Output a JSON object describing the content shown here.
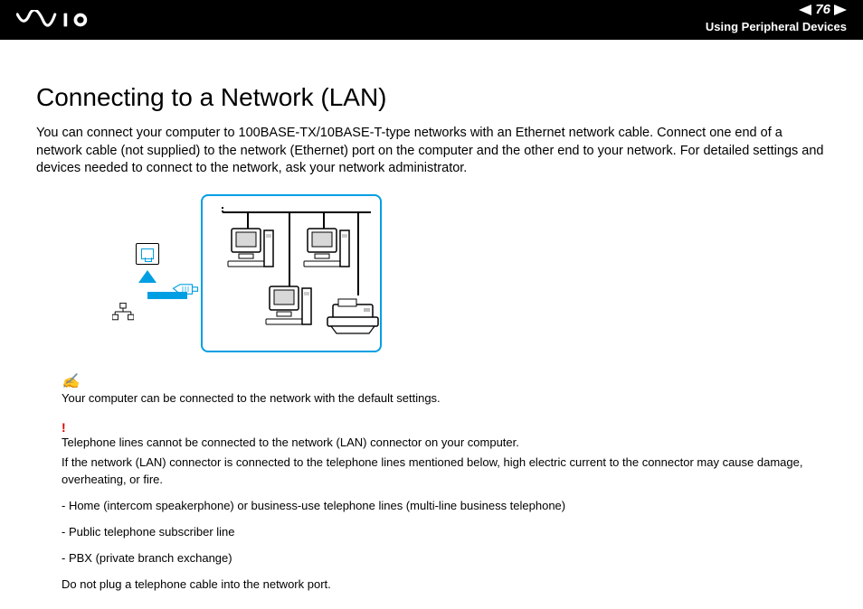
{
  "header": {
    "page_number": "76",
    "section": "Using Peripheral Devices"
  },
  "page": {
    "title": "Connecting to a Network (LAN)",
    "intro": "You can connect your computer to 100BASE-TX/10BASE-T-type networks with an Ethernet network cable. Connect one end of a network cable (not supplied) to the network (Ethernet) port on the computer and the other end to your network. For detailed settings and devices needed to connect to the network, ask your network administrator."
  },
  "note": {
    "text": "Your computer can be connected to the network with the default settings."
  },
  "warning": {
    "line1": "Telephone lines cannot be connected to the network (LAN) connector on your computer.",
    "line2": "If the network (LAN) connector is connected to the telephone lines mentioned below, high electric current to the connector may cause damage, overheating, or fire.",
    "bullets": [
      "- Home (intercom speakerphone) or business-use telephone lines (multi-line business telephone)",
      "- Public telephone subscriber line",
      "- PBX (private branch exchange)"
    ],
    "final": "Do not plug a telephone cable into the network port."
  }
}
